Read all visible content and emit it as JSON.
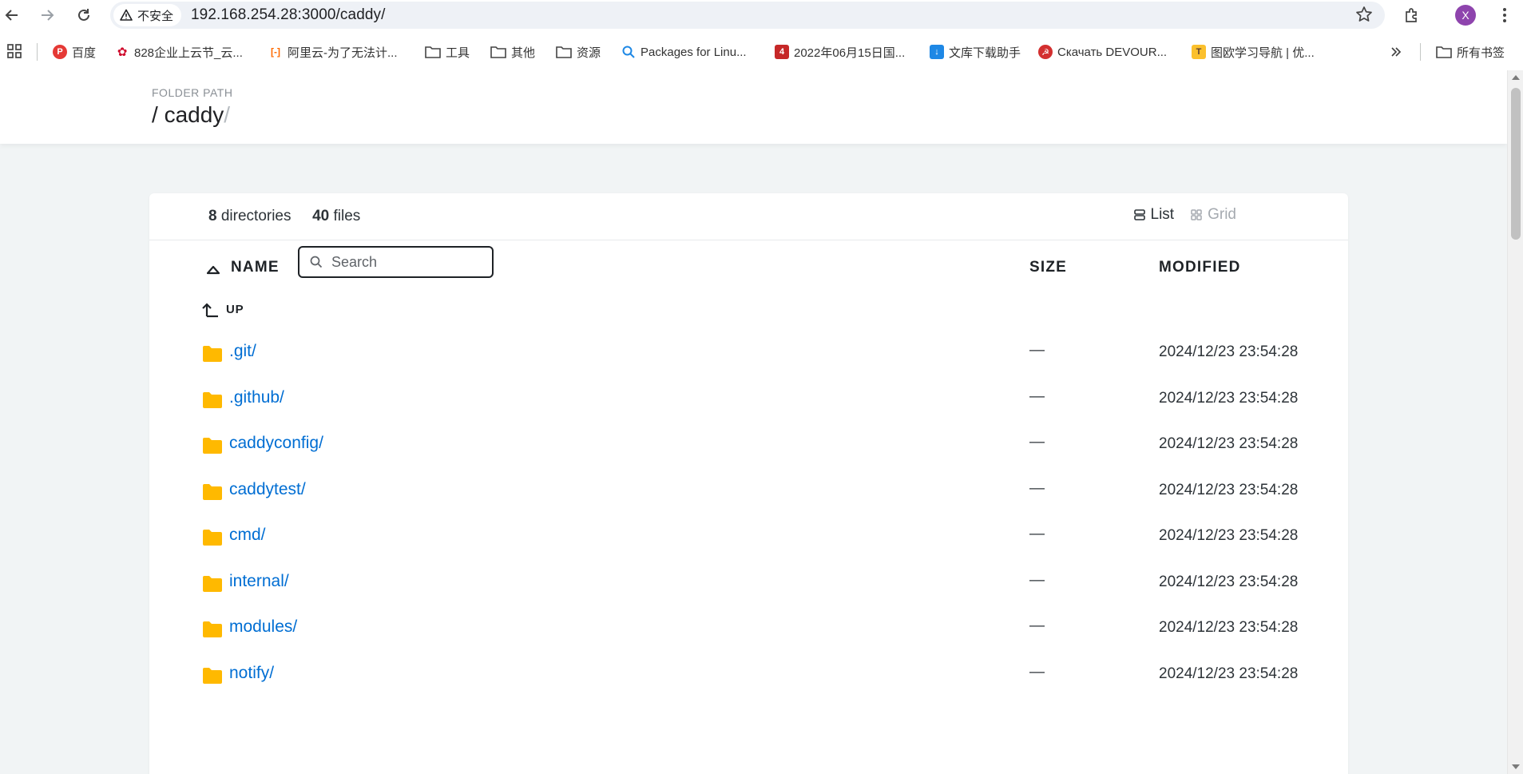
{
  "browser": {
    "security_label": "不安全",
    "url_host": "192.168.254.28",
    "url_rest": ":3000/caddy/",
    "avatar_letter": "X"
  },
  "bookmarks": [
    {
      "label": "百度",
      "icon": "baidu-icon",
      "color": "#e53935"
    },
    {
      "label": "828企业上云节_云...",
      "icon": "huawei-icon",
      "color": "#cf0a2c"
    },
    {
      "label": "阿里云-为了无法计...",
      "icon": "aliyun-icon",
      "color": "#ff6a00"
    },
    {
      "label": "工具",
      "icon": "folder-icon"
    },
    {
      "label": "其他",
      "icon": "folder-icon"
    },
    {
      "label": "资源",
      "icon": "folder-icon"
    },
    {
      "label": "Packages for Linu...",
      "icon": "search-icon"
    },
    {
      "label": "2022年06月15日国...",
      "icon": "site-icon",
      "color": "#c62828"
    },
    {
      "label": "文库下载助手",
      "icon": "doc-icon",
      "color": "#1e88e5"
    },
    {
      "label": "Скачать DEVOUR...",
      "icon": "site-icon",
      "color": "#d32f2f"
    },
    {
      "label": "图欧学习导航 | 优...",
      "icon": "site-icon",
      "color": "#fbc02d"
    }
  ],
  "bookmarks_all_label": "所有书签",
  "page": {
    "folder_label": "FOLDER PATH",
    "path_slash": "/",
    "path_name": "caddy",
    "path_trailing": "/",
    "summary": {
      "dir_count": "8",
      "dir_label": "directories",
      "file_count": "40",
      "file_label": "files"
    },
    "view": {
      "list_label": "List",
      "grid_label": "Grid"
    },
    "columns": {
      "name": "NAME",
      "size": "SIZE",
      "modified": "MODIFIED"
    },
    "search_placeholder": "Search",
    "up_label": "UP",
    "entries": [
      {
        "name": ".git/",
        "size": "—",
        "modified": "2024/12/23 23:54:28"
      },
      {
        "name": ".github/",
        "size": "—",
        "modified": "2024/12/23 23:54:28"
      },
      {
        "name": "caddyconfig/",
        "size": "—",
        "modified": "2024/12/23 23:54:28"
      },
      {
        "name": "caddytest/",
        "size": "—",
        "modified": "2024/12/23 23:54:28"
      },
      {
        "name": "cmd/",
        "size": "—",
        "modified": "2024/12/23 23:54:28"
      },
      {
        "name": "internal/",
        "size": "—",
        "modified": "2024/12/23 23:54:28"
      },
      {
        "name": "modules/",
        "size": "—",
        "modified": "2024/12/23 23:54:28"
      },
      {
        "name": "notify/",
        "size": "—",
        "modified": "2024/12/23 23:54:28"
      }
    ],
    "colors": {
      "link": "#006ed3",
      "folder": "#ffb900",
      "background": "#f1f4f5"
    }
  }
}
